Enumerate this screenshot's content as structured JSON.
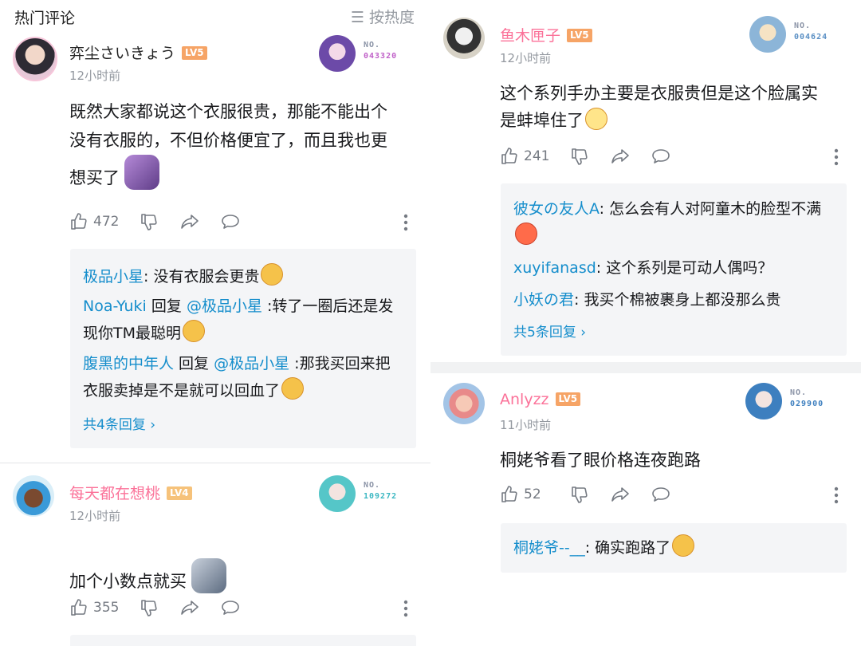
{
  "header": {
    "title": "热门评论",
    "sort_label": "☰ 按热度"
  },
  "left": {
    "c1": {
      "username": "弈尘さいきょう",
      "level": "LV5",
      "time": "12小时前",
      "badge_no": "NO.",
      "badge_num": "043320",
      "text": "既然大家都说这个衣服很贵，那能不能出个没有衣服的，不但价格便宜了，而且我也更想买了",
      "likes": "472",
      "replies": [
        {
          "user": "极品小星",
          "sep": ": ",
          "text": "没有衣服会更贵"
        },
        {
          "user": "Noa-Yuki",
          "mid": " 回复 ",
          "target": "@极品小星",
          "text": " :转了一圈后还是发现你TM最聪明"
        },
        {
          "user": "腹黑的中年人",
          "mid": " 回复 ",
          "target": "@极品小星",
          "text": " :那我买回来把衣服卖掉是不是就可以回血了"
        }
      ],
      "more": "共4条回复 ›"
    },
    "c2": {
      "username": "每天都在想桃",
      "level": "LV4",
      "time": "12小时前",
      "badge_no": "NO.",
      "badge_num": "109272",
      "text": "加个小数点就买",
      "likes": "355"
    }
  },
  "right": {
    "c1": {
      "username": "鱼木匣子",
      "level": "LV5",
      "time": "12小时前",
      "badge_no": "NO.",
      "badge_num": "004624",
      "text": "这个系列手办主要是衣服贵但是这个脸属实是蚌埠住了",
      "likes": "241",
      "replies": [
        {
          "user": "彼女の友人A",
          "sep": ": ",
          "text": "怎么会有人对阿童木的脸型不满"
        },
        {
          "user": "xuyifanasd",
          "sep": ": ",
          "text": "这个系列是可动人偶吗？"
        },
        {
          "user": "小妖の君",
          "sep": ": ",
          "text": "我买个棉被裹身上都没那么贵"
        }
      ],
      "more": "共5条回复 ›"
    },
    "c2": {
      "username": "Anlyzz",
      "level": "LV5",
      "time": "11小时前",
      "badge_no": "NO.",
      "badge_num": "029900",
      "text": "桐姥爷看了眼价格连夜跑路",
      "likes": "52",
      "replies": [
        {
          "user": "桐姥爷--__",
          "sep": ": ",
          "text": "确实跑路了"
        }
      ]
    }
  },
  "colors": {
    "pink_name": "#fb7299",
    "reply_blue": "#168ecc",
    "lv5": "#f6a466",
    "lv4": "#f6c27a",
    "meta_gray": "#9499a0"
  }
}
